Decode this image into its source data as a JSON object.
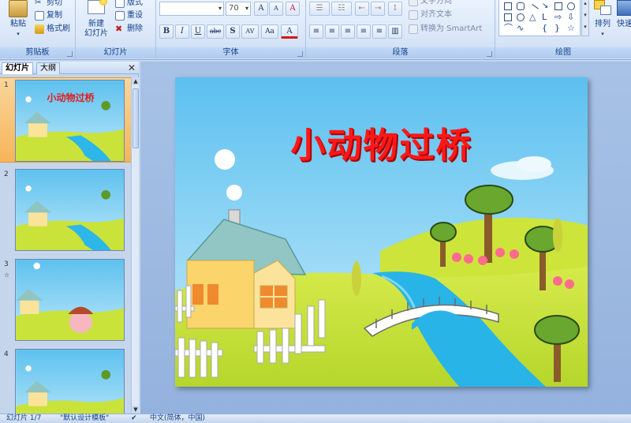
{
  "ribbon": {
    "clipboard": {
      "group_label": "剪贴板",
      "paste_label": "粘贴",
      "cut_label": "剪切",
      "copy_label": "复制",
      "format_painter_label": "格式刷"
    },
    "slides": {
      "group_label": "幻灯片",
      "new_slide_label_1": "新建",
      "new_slide_label_2": "幻灯片",
      "layout_label": "版式",
      "reset_label": "重设",
      "delete_label": "删除"
    },
    "font": {
      "group_label": "字体",
      "font_name_value": "",
      "font_size_value": "70",
      "grow_label": "A",
      "shrink_label": "A",
      "clear_label": "A",
      "bold_label": "B",
      "italic_label": "I",
      "underline_label": "U",
      "strike_label": "abc",
      "shadow_label": "S",
      "spacing_label": "AV",
      "case_label": "Aa",
      "color_label": "A"
    },
    "paragraph": {
      "group_label": "段落",
      "text_direction_label": "文字方向",
      "align_text_label": "对齐文本",
      "smartart_label": "转换为 SmartArt"
    },
    "drawing": {
      "group_label": "绘图",
      "arrange_label": "排列",
      "quick_styles_label": "快速"
    }
  },
  "left_pane": {
    "tab_slides": "幻灯片",
    "tab_outline": "大纲",
    "close_glyph": "✕",
    "thumbnails": [
      {
        "num": "1",
        "title": "小动物过桥",
        "anim": ""
      },
      {
        "num": "2",
        "title": "",
        "anim": ""
      },
      {
        "num": "3",
        "title": "",
        "anim": "☆"
      },
      {
        "num": "4",
        "title": "",
        "anim": ""
      }
    ]
  },
  "slide": {
    "title": "小动物过桥"
  },
  "status": {
    "slide_info": "幻灯片 1/7",
    "theme": "\"默认设计模板\"",
    "language": "中文(简体，中国)"
  },
  "colors": {
    "ribbon_bg": "#dce8f8",
    "sky": "#6cc6ee",
    "grass": "#c6e23a",
    "title_red": "#ff1818",
    "river": "#2ab3e6",
    "selected_thumb": "#f6b45a"
  },
  "icons": [
    "paste-icon",
    "cut-icon",
    "copy-icon",
    "format-painter-icon",
    "new-slide-icon",
    "layout-icon",
    "reset-icon",
    "delete-icon",
    "arrange-icon"
  ]
}
